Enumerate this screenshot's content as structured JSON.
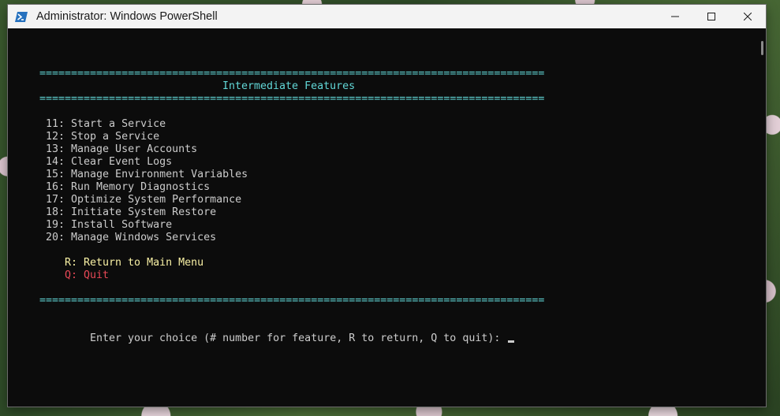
{
  "window": {
    "title": "Administrator: Windows PowerShell",
    "icon": "powershell-icon",
    "controls": {
      "minimize": "minimize-icon",
      "maximize": "maximize-icon",
      "close": "close-icon"
    }
  },
  "terminal": {
    "separator": "================================================================================",
    "heading": "Intermediate Features",
    "menu_items": [
      "11: Start a Service",
      "12: Stop a Service",
      "13: Manage User Accounts",
      "14: Clear Event Logs",
      "15: Manage Environment Variables",
      "16: Run Memory Diagnostics",
      "17: Optimize System Performance",
      "18: Initiate System Restore",
      "19: Install Software",
      "20: Manage Windows Services"
    ],
    "return_option": "R: Return to Main Menu",
    "quit_option": "Q: Quit",
    "prompt": "Enter your choice (# number for feature, R to return, Q to quit): "
  },
  "colors": {
    "background": "#0c0c0c",
    "separator": "#61d6d6",
    "text": "#cccccc",
    "return_option": "#f9f1a5",
    "quit_option": "#e74856"
  }
}
